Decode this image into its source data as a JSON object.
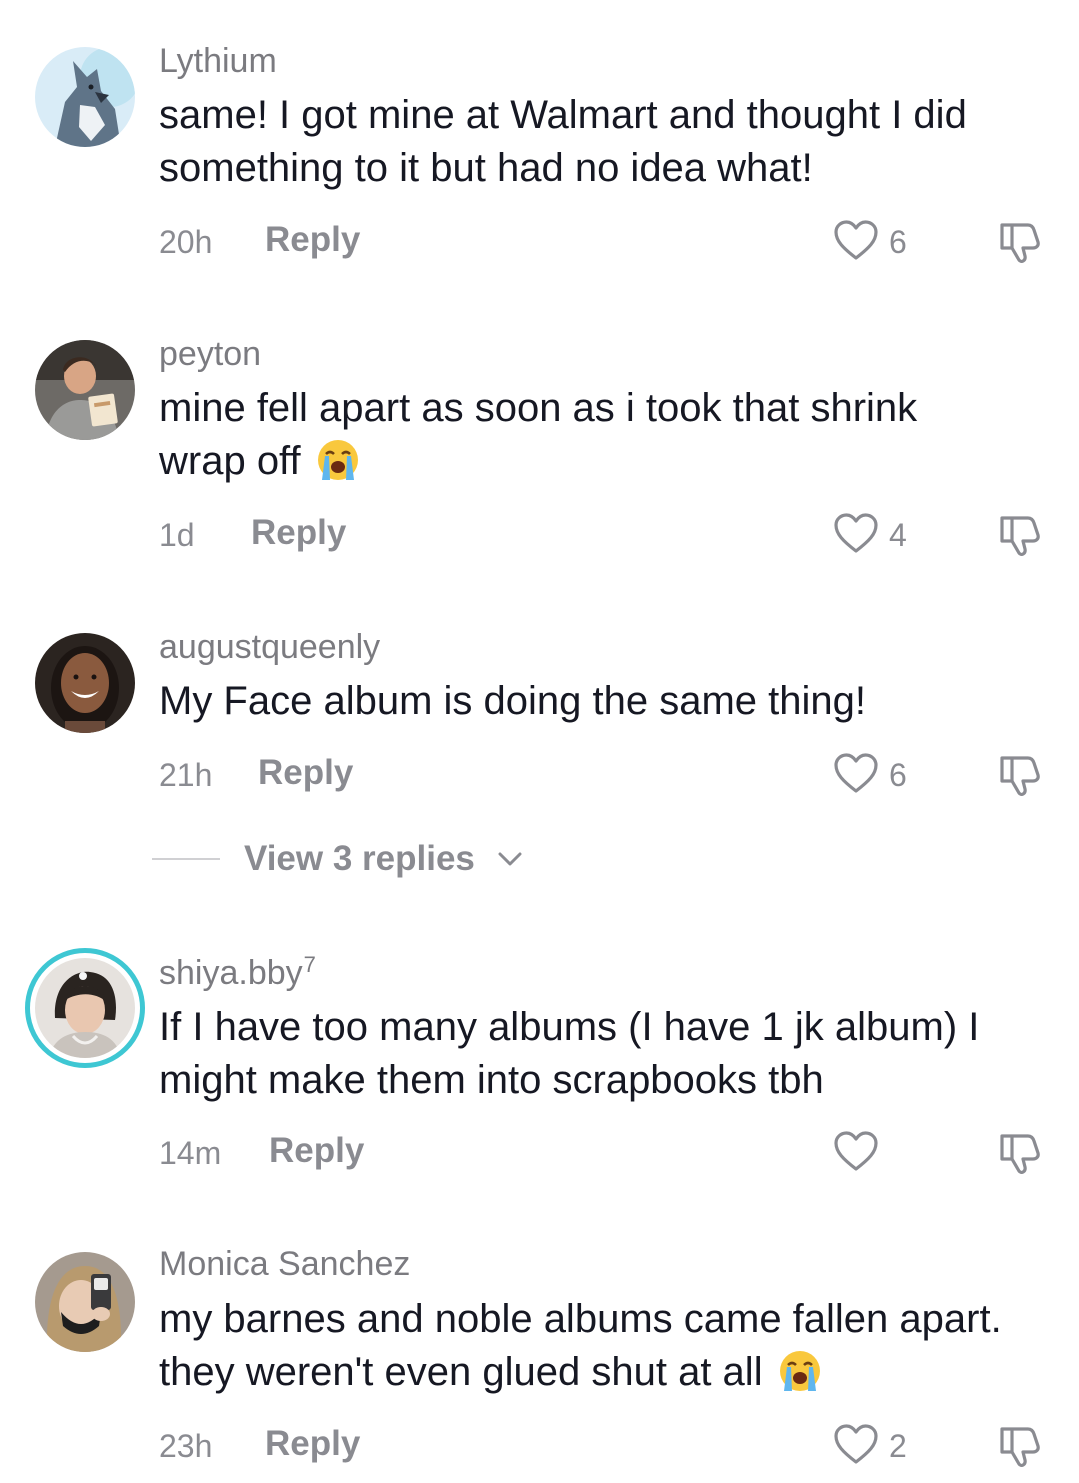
{
  "comments": [
    {
      "username": "Lythium",
      "badge": "",
      "text": "same! I got mine at Walmart and thought I did something to it but had no idea what!",
      "time": "20h",
      "reply_label": "Reply",
      "likes": "6",
      "avatar_icon": "wolf-avatar"
    },
    {
      "username": "peyton",
      "badge": "",
      "text": "mine fell apart as soon as i took that shrink wrap off",
      "emoji": "loudly-crying-face",
      "time": "1d",
      "reply_label": "Reply",
      "likes": "4",
      "avatar_icon": "person-photo-avatar"
    },
    {
      "username": "augustqueenly",
      "badge": "",
      "text": "My Face album is doing the same thing!",
      "time": "21h",
      "reply_label": "Reply",
      "likes": "6",
      "avatar_icon": "person-photo-avatar"
    },
    {
      "username": "shiya.bby",
      "badge": "7",
      "text": "If I have too many albums (I have 1 jk album) I might make them into scrapbooks tbh",
      "time": "14m",
      "reply_label": "Reply",
      "likes": "",
      "avatar_icon": "person-photo-avatar-story-ring"
    },
    {
      "username": "Monica Sanchez",
      "badge": "",
      "text": "my barnes and noble albums came fallen apart. they weren't even glued shut at all",
      "emoji": "loudly-crying-face",
      "time": "23h",
      "reply_label": "Reply",
      "likes": "2",
      "avatar_icon": "mirror-selfie-avatar"
    }
  ],
  "view_replies": {
    "label": "View 3 replies"
  },
  "colors": {
    "text": "#161823",
    "muted": "#8a8b91",
    "username": "#7b7b80",
    "story_ring": "#3ec7d3"
  }
}
